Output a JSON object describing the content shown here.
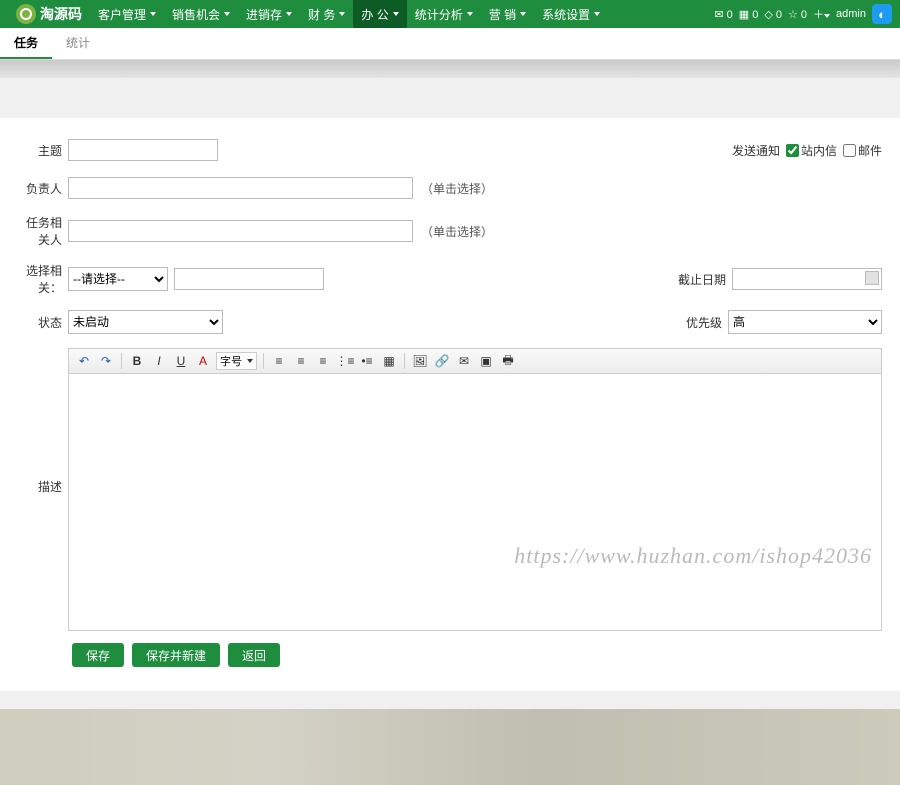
{
  "brand": "淘源码",
  "nav_items": [
    {
      "label": "客户管理"
    },
    {
      "label": "销售机会"
    },
    {
      "label": "进销存"
    },
    {
      "label": "财 务"
    },
    {
      "label": "办 公",
      "active": true
    },
    {
      "label": "统计分析"
    },
    {
      "label": "营 销"
    },
    {
      "label": "系统设置"
    }
  ],
  "top_right": {
    "mail_count": "0",
    "d1": "0",
    "d2": "0",
    "d3": "0",
    "user": "admin"
  },
  "subtabs": [
    {
      "label": "任务",
      "active": true
    },
    {
      "label": "统计"
    }
  ],
  "form": {
    "subject_label": "主题",
    "notify_label": "发送通知",
    "cb_site": "站内信",
    "cb_mail": "邮件",
    "principal_label": "负责人",
    "related_person_label": "任务相关人",
    "select_hint": "（单击选择）",
    "choose_related_label": "选择相关：",
    "choose_placeholder": "--请选择--",
    "deadline_label": "截止日期",
    "status_label": "状态",
    "status_value": "未启动",
    "priority_label": "优先级",
    "priority_value": "高",
    "desc_label": "描述",
    "editor": {
      "fontsize": "字号"
    },
    "buttons": {
      "save": "保存",
      "save_new": "保存并新建",
      "back": "返回"
    }
  },
  "watermark": "https://www.huzhan.com/ishop42036"
}
